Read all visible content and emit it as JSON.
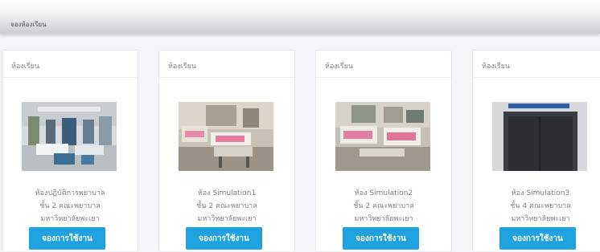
{
  "breadcrumb": "จองห้องเรียน",
  "cards": [
    {
      "header": "ห้องเรียน",
      "line1": "ห้องปฏิบัติการพยาบาล",
      "line2": "ชั้น 2 คณะพยาบาล",
      "line3": "มหาวิทยาลัยพะเยา",
      "button": "จองการใช้งาน",
      "image": "ward-photo"
    },
    {
      "header": "ห้องเรียน",
      "line1": "ห้อง Simulation1",
      "line2": "ชั้น 2 คณะพยาบาล",
      "line3": "มหาวิทยาลัยพะเยา",
      "button": "จองการใช้งาน",
      "image": "ward-photo"
    },
    {
      "header": "ห้องเรียน",
      "line1": "ห้อง Simulation2",
      "line2": "ชั้น 2 คณะพยาบาล",
      "line3": "มหาวิทยาลัยพะเยา",
      "button": "จองการใช้งาน",
      "image": "ward-photo"
    },
    {
      "header": "ห้องเรียน",
      "line1": "ห้อง Simulation3",
      "line2": "ชั้น 4 คณะพยาบาล",
      "line3": "มหาวิทยาลัยพะเยา",
      "button": "จองการใช้งาน",
      "image": "door-photo"
    }
  ]
}
